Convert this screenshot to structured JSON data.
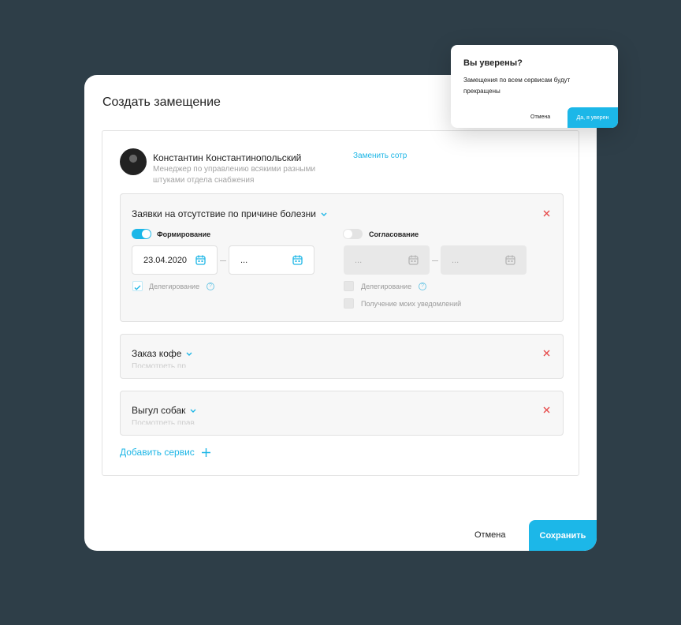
{
  "modal": {
    "title": "Создать замещение",
    "employee": {
      "name": "Константин Константинопольский",
      "role": "Менеджер по управлению всякими разными штуками отдела снабжения",
      "replace_link": "Заменить сотр"
    },
    "services": [
      {
        "title": "Заявки на отсутствие по причине болезни",
        "formation": {
          "label": "Формирование",
          "enabled": true,
          "date_from": "23.04.2020",
          "date_to": "...",
          "delegation_label": "Делегирование",
          "delegation_checked": true
        },
        "approval": {
          "label": "Согласование",
          "enabled": false,
          "date_from": "...",
          "date_to": "...",
          "delegation_label": "Делегирование",
          "notifications_label": "Получение моих уведомлений"
        }
      },
      {
        "title": "Заказ кофе",
        "faded_text": "Посмотреть пр"
      },
      {
        "title": "Выгул собак",
        "faded_text": "Посмотреть прав"
      }
    ],
    "add_service_label": "Добавить сервис",
    "cancel_label": "Отмена",
    "save_label": "Сохранить"
  },
  "confirm_popup": {
    "title": "Вы уверены?",
    "message": "Замещения по всем сервисам будут прекращены",
    "cancel_label": "Отмена",
    "confirm_label": "Да, я уверен"
  },
  "colors": {
    "accent": "#1cb7e8",
    "danger": "#e64a4a",
    "background": "#2e3e48"
  }
}
